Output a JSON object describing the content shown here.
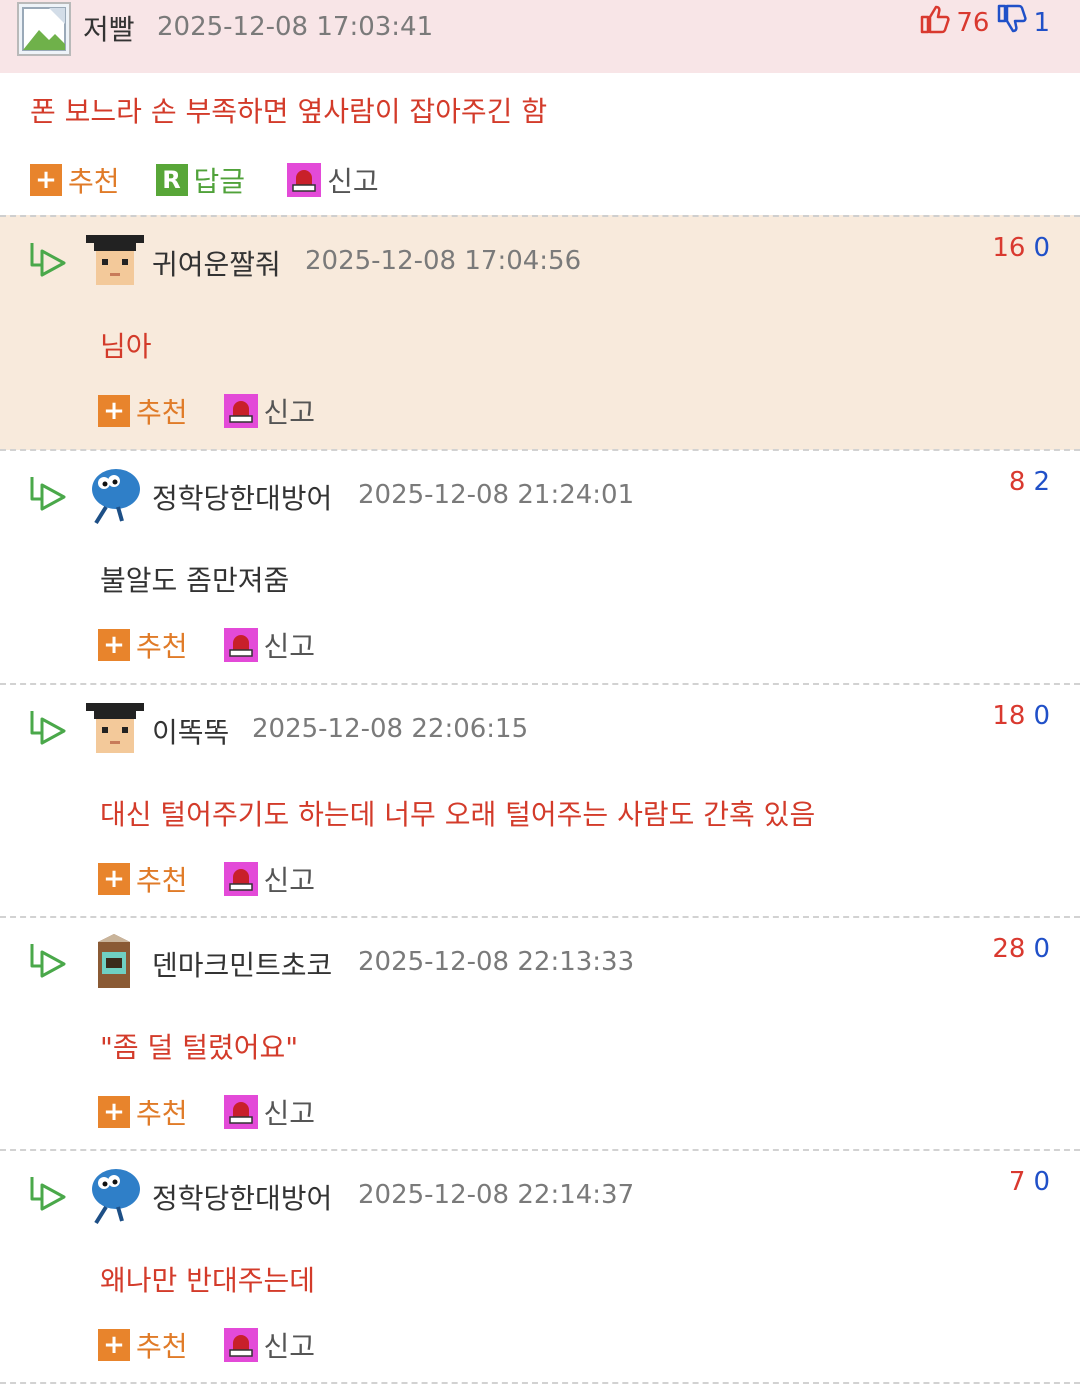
{
  "top_comment": {
    "nickname": "저빨",
    "timestamp": "2025-12-08 17:03:41",
    "upvotes": "76",
    "downvotes": "1",
    "body": "폰 보느라 손 부족하면 옆사람이 잡아주긴 함",
    "actions": {
      "recommend": "추천",
      "reply": "답글",
      "report": "신고"
    }
  },
  "replies": [
    {
      "nickname": "귀여운짤줘",
      "timestamp": "2025-12-08 17:04:56",
      "up": "16",
      "down": "0",
      "body": "님아",
      "avatar": "graduate-avatar-icon"
    },
    {
      "nickname": "정학당한대방어",
      "timestamp": "2025-12-08 21:24:01",
      "up": "8",
      "down": "2",
      "body": "불알도 좀만져줌",
      "avatar": "blue-fish-avatar-icon"
    },
    {
      "nickname": "이똑똑",
      "timestamp": "2025-12-08 22:06:15",
      "up": "18",
      "down": "0",
      "body": "대신 털어주기도 하는데 너무 오래 털어주는 사람도 간혹 있음",
      "avatar": "graduate-avatar-icon"
    },
    {
      "nickname": "덴마크민트초코",
      "timestamp": "2025-12-08 22:13:33",
      "up": "28",
      "down": "0",
      "body": "\"좀 덜 털렸어요\"",
      "avatar": "milk-carton-avatar-icon"
    },
    {
      "nickname": "정학당한대방어",
      "timestamp": "2025-12-08 22:14:37",
      "up": "7",
      "down": "0",
      "body": "왜나만 반대주는데",
      "avatar": "blue-fish-avatar-icon"
    }
  ],
  "reply_actions": {
    "recommend": "추천",
    "report": "신고"
  },
  "colors": {
    "accent_red": "#d33b2a",
    "recommend_orange": "#e07b28",
    "reply_green": "#50a23a",
    "highlight_bg": "#f8eadc",
    "header_pink": "#f8e5e7"
  }
}
